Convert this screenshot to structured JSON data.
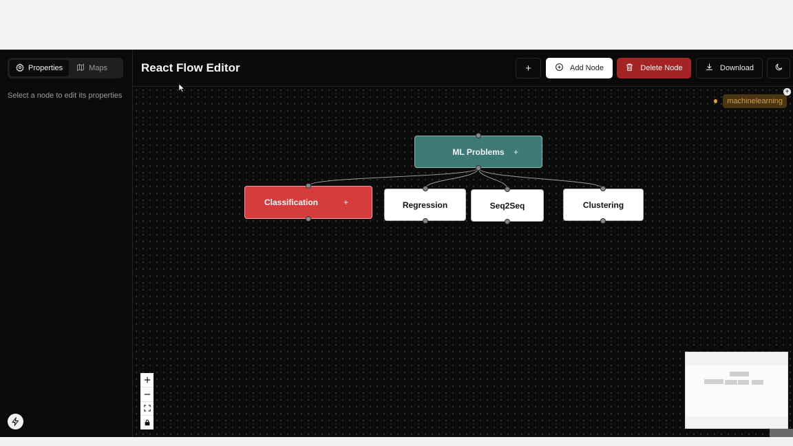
{
  "sidebar": {
    "tabs": [
      {
        "label": "Properties",
        "icon": "gear-icon",
        "active": true
      },
      {
        "label": "Maps",
        "icon": "map-icon",
        "active": false
      }
    ],
    "hint": "Select a node to edit its properties"
  },
  "header": {
    "title": "React Flow Editor",
    "buttons": {
      "plus": "+",
      "add_node": "Add Node",
      "delete_node": "Delete Node",
      "download": "Download"
    }
  },
  "canvas": {
    "map_tag": "machinelearning",
    "nodes": {
      "root": {
        "label": "ML Problems",
        "color": "#3e7b78"
      },
      "classification": {
        "label": "Classification",
        "color": "#d63c3c"
      },
      "regression": {
        "label": "Regression",
        "color": "#ffffff"
      },
      "seq2seq": {
        "label": "Seq2Seq",
        "color": "#ffffff"
      },
      "clustering": {
        "label": "Clustering",
        "color": "#ffffff"
      }
    },
    "node_plus": "+",
    "controls": [
      "zoom-in",
      "zoom-out",
      "fit-view",
      "lock"
    ]
  },
  "colors": {
    "accent_teal": "#3e7b78",
    "danger": "#a42424",
    "tag": "#e0a43a"
  }
}
